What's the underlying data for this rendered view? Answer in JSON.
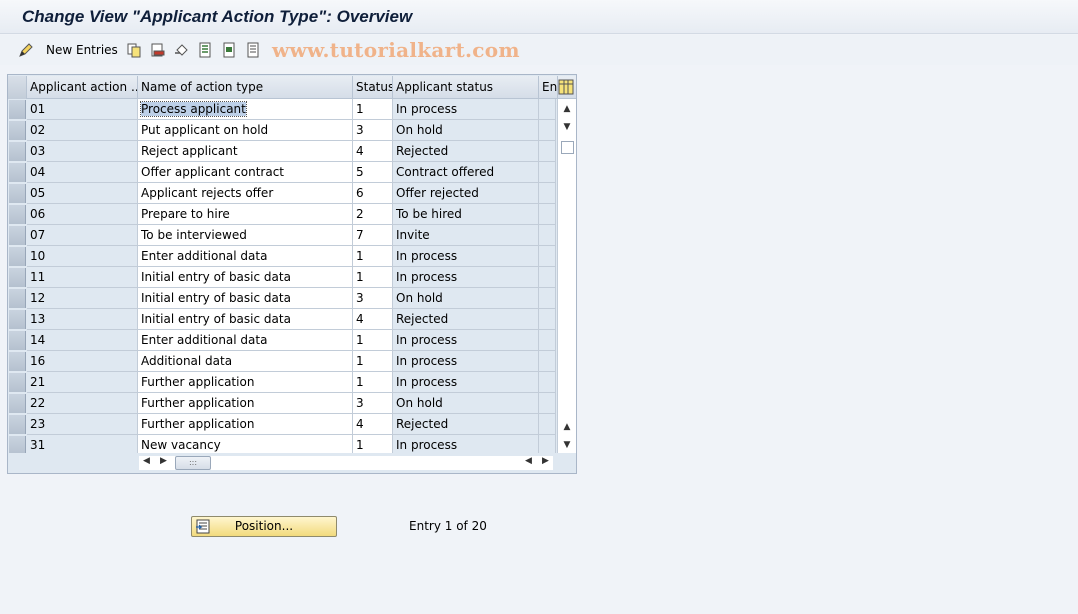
{
  "title": "Change View \"Applicant Action Type\": Overview",
  "toolbar": {
    "new_entries_label": "New Entries",
    "watermark": "www.tutorialkart.com",
    "icons": [
      "pencil-icon",
      "copy-icon",
      "delete-icon",
      "undo-icon",
      "select-all-icon",
      "select-block-icon",
      "deselect-all-icon"
    ]
  },
  "table": {
    "columns": [
      "Applicant action ...",
      "Name of action type",
      "Status",
      "Applicant status",
      "Ent"
    ],
    "rows": [
      {
        "key": "01",
        "name": "Process applicant",
        "status": "1",
        "applicant_status": "In process"
      },
      {
        "key": "02",
        "name": "Put applicant on hold",
        "status": "3",
        "applicant_status": "On hold"
      },
      {
        "key": "03",
        "name": "Reject applicant",
        "status": "4",
        "applicant_status": "Rejected"
      },
      {
        "key": "04",
        "name": "Offer applicant contract",
        "status": "5",
        "applicant_status": "Contract offered"
      },
      {
        "key": "05",
        "name": "Applicant rejects offer",
        "status": "6",
        "applicant_status": "Offer rejected"
      },
      {
        "key": "06",
        "name": "Prepare to hire",
        "status": "2",
        "applicant_status": "To be hired"
      },
      {
        "key": "07",
        "name": "To be interviewed",
        "status": "7",
        "applicant_status": "Invite"
      },
      {
        "key": "10",
        "name": "Enter additional data",
        "status": "1",
        "applicant_status": "In process"
      },
      {
        "key": "11",
        "name": "Initial entry of basic data",
        "status": "1",
        "applicant_status": "In process"
      },
      {
        "key": "12",
        "name": "Initial entry of basic data",
        "status": "3",
        "applicant_status": "On hold"
      },
      {
        "key": "13",
        "name": "Initial entry of basic data",
        "status": "4",
        "applicant_status": "Rejected"
      },
      {
        "key": "14",
        "name": "Enter additional data",
        "status": "1",
        "applicant_status": "In process"
      },
      {
        "key": "16",
        "name": "Additional data",
        "status": "1",
        "applicant_status": "In process"
      },
      {
        "key": "21",
        "name": "Further application",
        "status": "1",
        "applicant_status": "In process"
      },
      {
        "key": "22",
        "name": "Further application",
        "status": "3",
        "applicant_status": "On hold"
      },
      {
        "key": "23",
        "name": "Further application",
        "status": "4",
        "applicant_status": "Rejected"
      },
      {
        "key": "31",
        "name": "New vacancy",
        "status": "1",
        "applicant_status": "In process"
      }
    ]
  },
  "footer": {
    "position_button_label": "Position...",
    "entry_info": "Entry 1 of 20"
  },
  "colors": {
    "accent_yellow": "#f2da7d",
    "table_bg": "#dfe8f1",
    "watermark": "#f0b38a"
  }
}
